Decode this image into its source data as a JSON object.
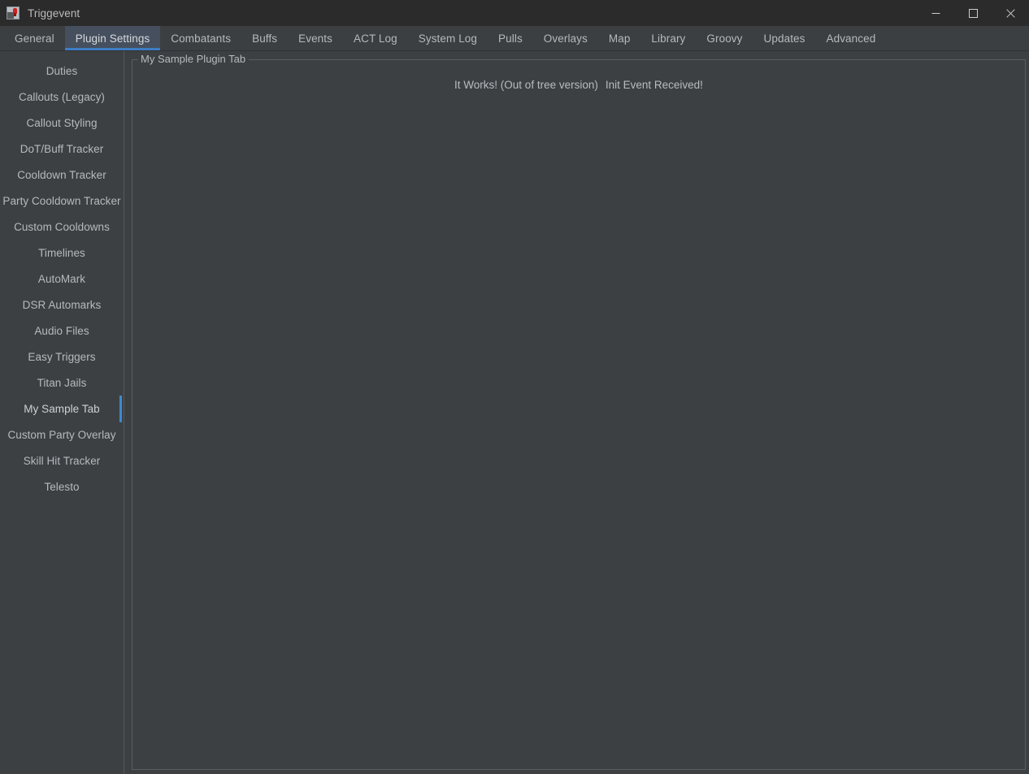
{
  "window": {
    "title": "Triggevent",
    "icon": "app-icon",
    "controls": [
      {
        "name": "minimize",
        "glyph": "minimize-icon"
      },
      {
        "name": "maximize",
        "glyph": "maximize-icon"
      },
      {
        "name": "close",
        "glyph": "close-icon"
      }
    ]
  },
  "tabs": {
    "active": "Plugin Settings",
    "items": [
      {
        "label": "General",
        "active": false
      },
      {
        "label": "Plugin Settings",
        "active": true
      },
      {
        "label": "Combatants",
        "active": false
      },
      {
        "label": "Buffs",
        "active": false
      },
      {
        "label": "Events",
        "active": false
      },
      {
        "label": "ACT Log",
        "active": false
      },
      {
        "label": "System Log",
        "active": false
      },
      {
        "label": "Pulls",
        "active": false
      },
      {
        "label": "Overlays",
        "active": false
      },
      {
        "label": "Map",
        "active": false
      },
      {
        "label": "Library",
        "active": false
      },
      {
        "label": "Groovy",
        "active": false
      },
      {
        "label": "Updates",
        "active": false
      },
      {
        "label": "Advanced",
        "active": false
      }
    ]
  },
  "sidebar": {
    "selected": "My Sample Tab",
    "items": [
      {
        "label": "Duties",
        "selected": false
      },
      {
        "label": "Callouts (Legacy)",
        "selected": false
      },
      {
        "label": "Callout Styling",
        "selected": false
      },
      {
        "label": "DoT/Buff Tracker",
        "selected": false
      },
      {
        "label": "Cooldown Tracker",
        "selected": false
      },
      {
        "label": "Party Cooldown Tracker",
        "selected": false
      },
      {
        "label": "Custom Cooldowns",
        "selected": false
      },
      {
        "label": "Timelines",
        "selected": false
      },
      {
        "label": "AutoMark",
        "selected": false
      },
      {
        "label": "DSR Automarks",
        "selected": false
      },
      {
        "label": "Audio Files",
        "selected": false
      },
      {
        "label": "Easy Triggers",
        "selected": false
      },
      {
        "label": "Titan Jails",
        "selected": false
      },
      {
        "label": "My Sample Tab",
        "selected": true
      },
      {
        "label": "Custom Party Overlay",
        "selected": false
      },
      {
        "label": "Skill Hit Tracker",
        "selected": false
      },
      {
        "label": "Telesto",
        "selected": false
      }
    ]
  },
  "main": {
    "group_title": "My Sample Plugin Tab",
    "messages": [
      {
        "text": "It Works! (Out of tree version)"
      },
      {
        "text": "Init Event Received!"
      }
    ]
  },
  "colors": {
    "titlebar_bg": "#2b2b2b",
    "tabbar_bg": "#3c3f41",
    "content_bg": "#3c4043",
    "accent_blue": "#3d7dc4",
    "selection_blue": "#3d8ad1",
    "text": "#b6babd",
    "border": "#5a5e61"
  }
}
